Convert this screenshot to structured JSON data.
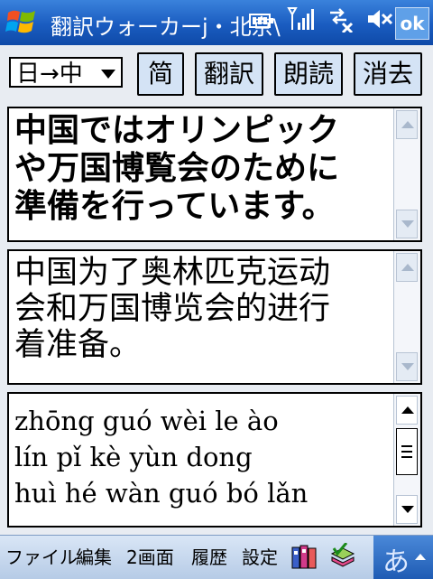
{
  "titlebar": {
    "title": "翻訳ウォーカーj・北京\\",
    "ok_label": "ok"
  },
  "toolbar": {
    "direction_value": "日→中",
    "simplified_label": "简",
    "translate_label": "翻訳",
    "read_aloud_label": "朗読",
    "clear_label": "消去"
  },
  "panes": {
    "source_lines": [
      "中国ではオリンピック",
      "や万国博覧会のために",
      "準備を行っています。"
    ],
    "target_lines": [
      "中国为了奥林匹克运动",
      "会和万国博览会的进行",
      "着准备。"
    ],
    "pinyin_lines": [
      "zhōng guó wèi le ào",
      "lín pǐ kè yùn dong",
      "huì hé wàn guó bó lǎn"
    ]
  },
  "menubar": {
    "file": "ファイル",
    "edit": "編集",
    "split": "2画面",
    "history": "履歴",
    "settings": "設定",
    "ime": "あ"
  },
  "colors": {
    "titlebar": "#1a5cc0",
    "button_face": "#d4e3f5",
    "background": "#e8ecf2"
  }
}
